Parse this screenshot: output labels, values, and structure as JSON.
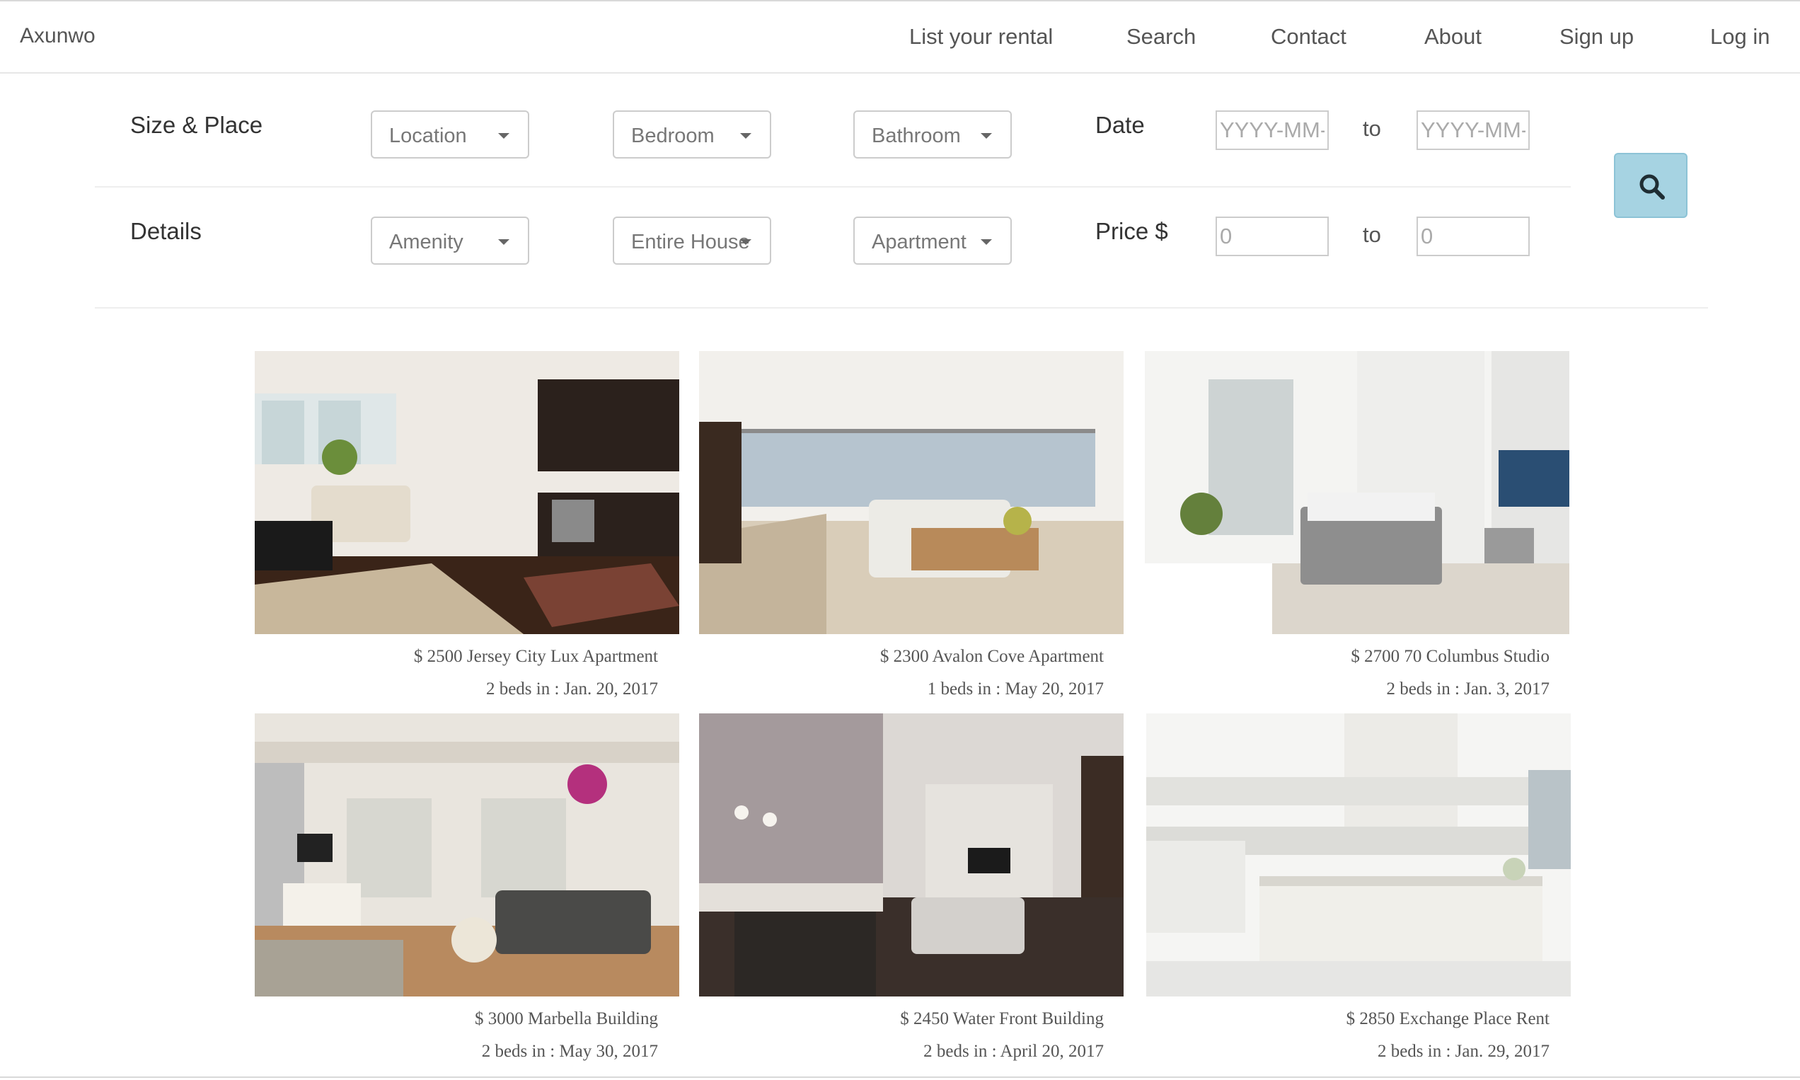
{
  "navbar": {
    "brand": "Axunwo",
    "links": [
      "List your rental",
      "Search",
      "Contact",
      "About",
      "Sign up",
      "Log in"
    ]
  },
  "filters": {
    "size_place_label": "Size & Place",
    "details_label": "Details",
    "location": "Location",
    "bedroom": "Bedroom",
    "bathroom": "Bathroom",
    "amenity": "Amenity",
    "rental_type": "Entire House",
    "property_type": "Apartment",
    "date_label": "Date",
    "date_from_placeholder": "YYYY-MM-DD",
    "date_to_placeholder": "YYYY-MM-DD",
    "price_label": "Price $",
    "price_from_placeholder": "0",
    "price_to_placeholder": "0",
    "to_label": "to",
    "search_icon": "search-icon",
    "search_button_color": "#a6d3e2"
  },
  "listings": [
    {
      "title": "$ 2500 Jersey City Lux Apartment",
      "beds": "2 beds in : Jan. 20, 2017"
    },
    {
      "title": "$ 2300 Avalon Cove Apartment",
      "beds": "1 beds in : May 20, 2017"
    },
    {
      "title": "$ 2700 70 Columbus Studio",
      "beds": "2 beds in : Jan. 3, 2017"
    },
    {
      "title": "$ 3000 Marbella Building",
      "beds": "2 beds in : May 30, 2017"
    },
    {
      "title": "$ 2450 Water Front Building",
      "beds": "2 beds in : April 20, 2017"
    },
    {
      "title": "$ 2850 Exchange Place Rent",
      "beds": "2 beds in : Jan. 29, 2017"
    }
  ]
}
